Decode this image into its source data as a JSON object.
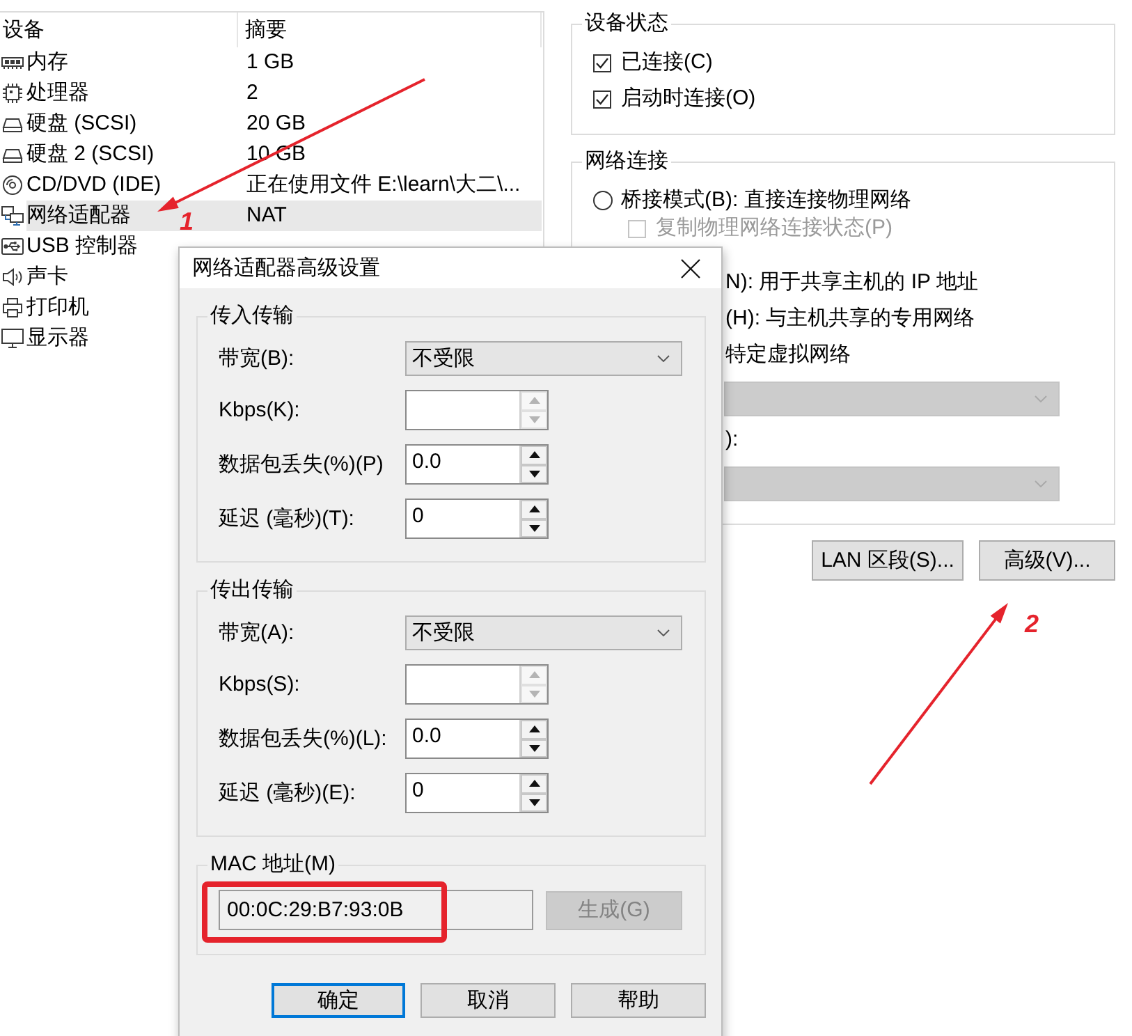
{
  "device_table": {
    "columns": [
      "设备",
      "摘要"
    ],
    "rows": [
      {
        "kind": "memory",
        "device": "内存",
        "summary": "1 GB",
        "selected": false
      },
      {
        "kind": "cpu",
        "device": "处理器",
        "summary": "2",
        "selected": false
      },
      {
        "kind": "disk",
        "device": "硬盘 (SCSI)",
        "summary": "20 GB",
        "selected": false
      },
      {
        "kind": "disk",
        "device": "硬盘 2 (SCSI)",
        "summary": "10 GB",
        "selected": false
      },
      {
        "kind": "disc",
        "device": "CD/DVD (IDE)",
        "summary": "正在使用文件 E:\\learn\\大二\\...",
        "selected": false
      },
      {
        "kind": "network",
        "device": "网络适配器",
        "summary": "NAT",
        "selected": true
      },
      {
        "kind": "usb",
        "device": "USB 控制器",
        "selected": false
      },
      {
        "kind": "speaker",
        "device": "声卡",
        "selected": false
      },
      {
        "kind": "printer",
        "device": "打印机",
        "selected": false
      },
      {
        "kind": "monitor",
        "device": "显示器",
        "selected": false
      }
    ]
  },
  "device_status": {
    "title": "设备状态",
    "options": [
      {
        "label": "已连接(C)",
        "checked": true
      },
      {
        "label": "启动时连接(O)",
        "checked": true
      }
    ]
  },
  "network_connection": {
    "title": "网络连接",
    "items": [
      {
        "kind": "radio",
        "label": "桥接模式(B): 直接连接物理网络",
        "selected": false
      },
      {
        "kind": "checkbox",
        "label": "复制物理网络连接状态(P)",
        "checked": false,
        "disabled": true
      },
      {
        "kind": "text",
        "label": "N): 用于共享主机的 IP 地址"
      },
      {
        "kind": "text",
        "label": "(H): 与主机共享的专用网络"
      },
      {
        "kind": "text",
        "label": "特定虚拟网络"
      },
      {
        "kind": "dropdown",
        "disabled": true
      },
      {
        "kind": "text",
        "label": "):"
      },
      {
        "kind": "dropdown",
        "disabled": true
      }
    ]
  },
  "network_buttons": [
    "LAN 区段(S)...",
    "高级(V)..."
  ],
  "dialog": {
    "title": "网络适配器高级设置",
    "groups": [
      {
        "title": "传入传输",
        "fields": [
          {
            "kind": "dropdown",
            "label": "带宽(B):",
            "value": "不受限"
          },
          {
            "kind": "spinner",
            "label": "Kbps(K):",
            "disabled": true
          },
          {
            "kind": "spinner",
            "label": "数据包丢失(%)(P)",
            "value": "0.0",
            "disabled": false
          },
          {
            "kind": "spinner",
            "label": "延迟 (毫秒)(T):",
            "value": "0",
            "disabled": false
          }
        ]
      },
      {
        "title": "传出传输",
        "fields": [
          {
            "kind": "dropdown",
            "label": "带宽(A):",
            "value": "不受限"
          },
          {
            "kind": "spinner",
            "label": "Kbps(S):",
            "disabled": true
          },
          {
            "kind": "spinner",
            "label": "数据包丢失(%)(L):",
            "value": "0.0",
            "disabled": false
          },
          {
            "kind": "spinner",
            "label": "延迟 (毫秒)(E):",
            "value": "0",
            "disabled": false
          }
        ]
      }
    ],
    "mac": {
      "title": "MAC 地址(M)",
      "value": "00:0C:29:B7:93:0B",
      "highlighted": true,
      "generate_button": {
        "label": "生成(G)",
        "disabled": true
      }
    },
    "buttons": [
      {
        "label": "确定",
        "default": true
      },
      {
        "label": "取消",
        "default": false
      },
      {
        "label": "帮助",
        "default": false
      }
    ]
  },
  "annotations": [
    {
      "label": "1"
    },
    {
      "label": "2"
    }
  ]
}
